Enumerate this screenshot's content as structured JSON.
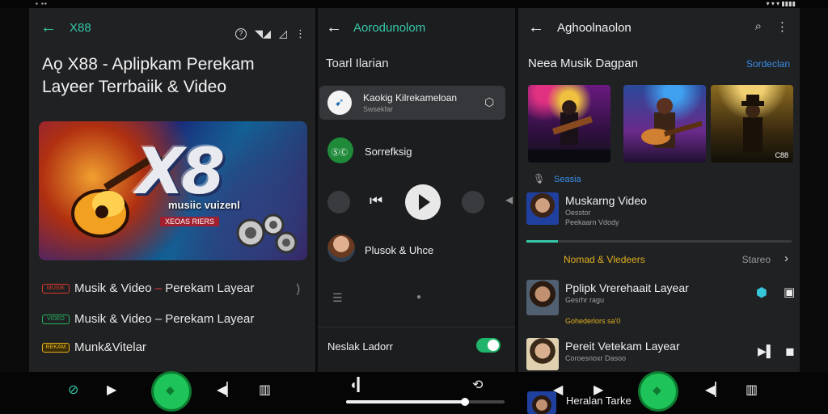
{
  "panel1": {
    "app_title": "X88",
    "headline": "Aǫ X88 - Aplipkam Perekam Layeer Terrbaiik & Video",
    "hero": {
      "logo": "X8",
      "sub": "musiic vuizenl",
      "tag": "XEOAS RIERS"
    },
    "features": [
      {
        "badge": "MUSIK",
        "text_a": "Musik & Video ",
        "dash": "–",
        "text_b": " Perekam Layear",
        "color": "#d93a2a"
      },
      {
        "badge": "VIDEO",
        "text_a": "Musik & Video ",
        "dash": "–",
        "text_b": " Perekam Layear",
        "color": "#27b060"
      },
      {
        "badge": "REKAM",
        "text_a": "Munk&Vitelar",
        "dash": "",
        "text_b": "",
        "color": "#e8b21a"
      }
    ]
  },
  "panel2": {
    "app_title": "Aorodunolom",
    "section": "Toarl Ilarian",
    "items": [
      {
        "title": "Kaokig Kilrekameloan",
        "sub": "Swsekfar"
      },
      {
        "title": "Sorrefksig",
        "sub": ""
      },
      {
        "title": "Plusok & Uhce",
        "sub": ""
      }
    ],
    "toggle_label": "Neslak Ladorr",
    "toggle_on": true
  },
  "panel3": {
    "app_title": "Aghoolnaolon",
    "section": "Neea Musik Dagpan",
    "link": "Sordeclan",
    "thumb_badge": "C88",
    "tag": "Seasia",
    "now_playing": {
      "title": "Muskarng Video",
      "sub": "Oesstor",
      "meta": "Peekaarn Vdody"
    },
    "progress": 0.12,
    "subheader": {
      "label": "Nomad & Vledeers",
      "action": "Stareo"
    },
    "rows": [
      {
        "title": "Pplipk Vrerehaait Layear",
        "sub": "Gesrhr ragu",
        "meta": "Gohederlors sa'0"
      },
      {
        "title": "Pereit Vetekam Layear",
        "sub": "Coroesnoxr Dasoo",
        "meta": ""
      },
      {
        "title": "Heralan Tarke",
        "sub": "",
        "meta": ""
      }
    ]
  },
  "nav": {
    "seek_progress": 0.75
  }
}
